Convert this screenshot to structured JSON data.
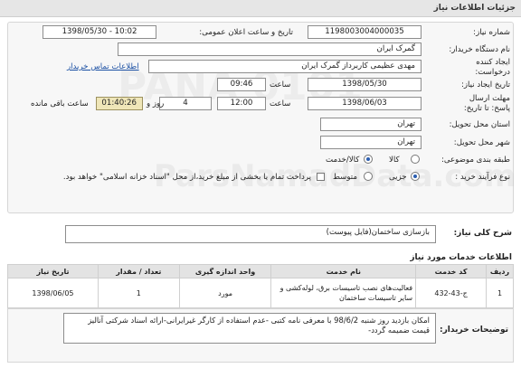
{
  "title_bar": {
    "text": "جزئیات اطلاعات نیاز"
  },
  "form": {
    "need_number": {
      "label": "شماره نیاز:",
      "value": "1198003004000035"
    },
    "announce_datetime": {
      "label": "تاریخ و ساعت اعلان عمومی:",
      "value": "1398/05/30 - 10:02"
    },
    "buyer_org": {
      "label": "نام دستگاه خریدار:",
      "value": "گمرک ایران"
    },
    "requester": {
      "label": "ایجاد کننده درخواست:",
      "value": "مهدی عظیمی کاربرداز گمرک ایران",
      "contact_link": "اطلاعات تماس خریدار"
    },
    "create_date": {
      "label": "تاریخ ایجاد نیاز:",
      "value": "1398/05/30",
      "time_label": "ساعت",
      "time": "09:46"
    },
    "deadline": {
      "label": "مهلت ارسال پاسخ: تا تاریخ:",
      "value": "1398/06/03",
      "time_label": "ساعت",
      "time": "12:00",
      "days_label": "روز و",
      "days": "4",
      "remaining_time": "01:40:26",
      "remaining_label": "ساعت باقی مانده"
    },
    "delivery_province": {
      "label": "استان محل تحویل:",
      "value": "تهران"
    },
    "delivery_city": {
      "label": "شهر محل تحویل:",
      "value": "تهران"
    },
    "category": {
      "label": "طبقه بندی موضوعی:",
      "options": [
        "کالا",
        "کالا/خدمت"
      ],
      "selected": "کالا/خدمت"
    },
    "purchase_type": {
      "label": "نوع فرآیند خرید :",
      "options": [
        "جزیی",
        "متوسط"
      ],
      "selected": "جزیی",
      "note": "پرداخت تمام یا بخشی از مبلغ خرید،از محل \"اسناد خزانه اسلامی\" خواهد بود."
    }
  },
  "summary": {
    "label": "شرح کلی نیاز:",
    "value": "بازسازی ساختمان(فایل پیوست)"
  },
  "services": {
    "section_title": "اطلاعات خدمات مورد نیاز",
    "headers": [
      "ردیف",
      "کد خدمت",
      "نام خدمت",
      "واحد اندازه گیری",
      "تعداد / مقدار",
      "تاریخ نیاز"
    ],
    "rows": [
      {
        "index": "1",
        "code": "ج-43-432",
        "name": "فعالیت‌های نصب تاسیسات برق، لوله‌کشی و سایر تاسیسات ساختمان",
        "unit": "مورد",
        "qty": "1",
        "date": "1398/06/05"
      }
    ]
  },
  "notes": {
    "label": "توضیحات خریدار:",
    "value": "امکان بازدید روز شنبه 98/6/2 با معرفی نامه کتبی -عدم استفاده از کارگر غیرایرانی-ارائه اسناد شرکتی آنالیز قیمت ضمیمه گردد-"
  },
  "watermark": {
    "text1": "PANA 0101",
    "text2": "ParsNamadData.com"
  }
}
